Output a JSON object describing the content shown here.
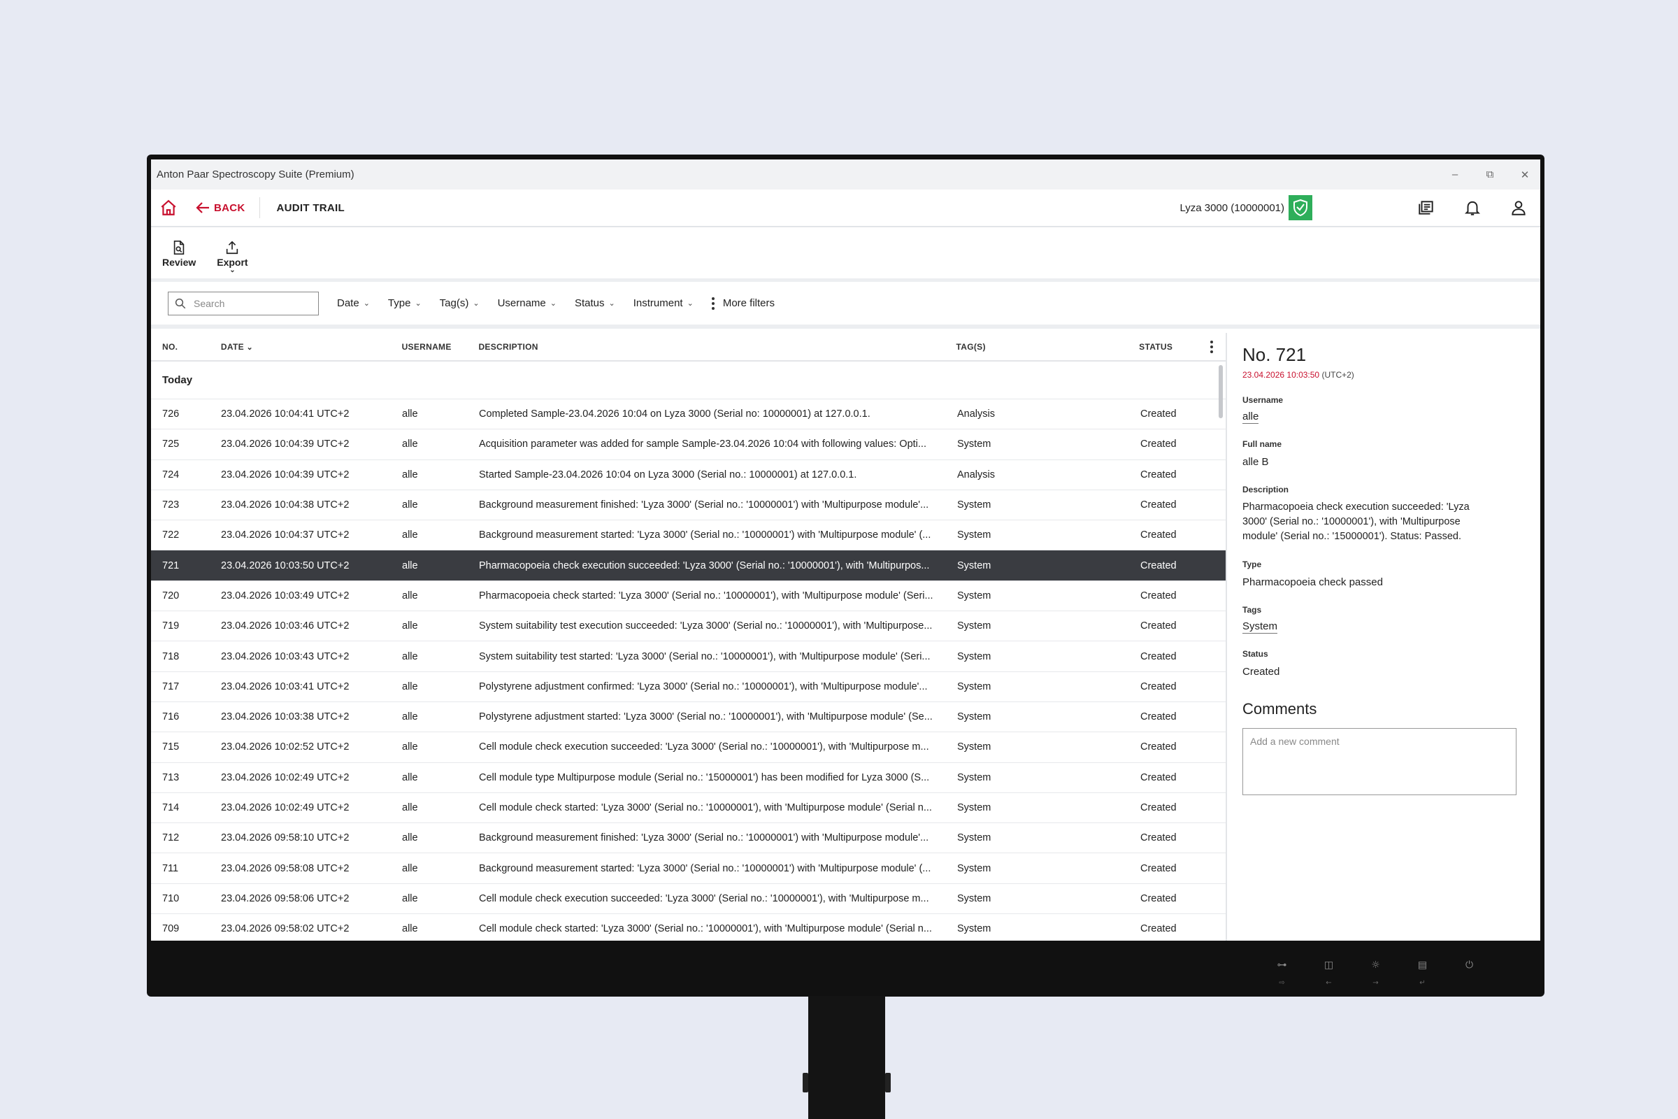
{
  "window": {
    "title": "Anton Paar Spectroscopy Suite (Premium)",
    "minimize": "–",
    "restore": "⧉",
    "close": "✕"
  },
  "appbar": {
    "back_label": "BACK",
    "page_title": "AUDIT TRAIL",
    "instrument": "Lyza 3000 (10000001)",
    "brand_red": "#c8102e",
    "status_green": "#2eae5a"
  },
  "toolbar": {
    "review_label": "Review",
    "export_label": "Export"
  },
  "filters": {
    "search_placeholder": "Search",
    "items": [
      "Date",
      "Type",
      "Tag(s)",
      "Username",
      "Status",
      "Instrument"
    ],
    "more_label": "More filters"
  },
  "table": {
    "columns": {
      "no": "NO.",
      "date": "DATE",
      "username": "USERNAME",
      "description": "DESCRIPTION",
      "tags": "TAG(S)",
      "status": "STATUS"
    },
    "group_label": "Today",
    "rows": [
      {
        "no": "726",
        "date": "23.04.2026 10:04:41 UTC+2",
        "user": "alle",
        "desc": "Completed Sample-23.04.2026 10:04 on Lyza 3000 (Serial no: 10000001) at 127.0.0.1.",
        "tags": "Analysis",
        "status": "Created"
      },
      {
        "no": "725",
        "date": "23.04.2026 10:04:39 UTC+2",
        "user": "alle",
        "desc": "Acquisition parameter was added for sample Sample-23.04.2026 10:04 with following values: Opti...",
        "tags": "System",
        "status": "Created"
      },
      {
        "no": "724",
        "date": "23.04.2026 10:04:39 UTC+2",
        "user": "alle",
        "desc": "Started Sample-23.04.2026 10:04 on Lyza 3000 (Serial no.: 10000001) at 127.0.0.1.",
        "tags": "Analysis",
        "status": "Created"
      },
      {
        "no": "723",
        "date": "23.04.2026 10:04:38 UTC+2",
        "user": "alle",
        "desc": "Background measurement finished: 'Lyza 3000' (Serial no.: '10000001') with 'Multipurpose module'...",
        "tags": "System",
        "status": "Created"
      },
      {
        "no": "722",
        "date": "23.04.2026 10:04:37 UTC+2",
        "user": "alle",
        "desc": "Background measurement started: 'Lyza 3000' (Serial no.: '10000001') with 'Multipurpose module' (...",
        "tags": "System",
        "status": "Created"
      },
      {
        "no": "721",
        "date": "23.04.2026 10:03:50 UTC+2",
        "user": "alle",
        "desc": "Pharmacopoeia check execution succeeded: 'Lyza 3000' (Serial no.: '10000001'), with 'Multipurpos...",
        "tags": "System",
        "status": "Created"
      },
      {
        "no": "720",
        "date": "23.04.2026 10:03:49 UTC+2",
        "user": "alle",
        "desc": "Pharmacopoeia check started: 'Lyza 3000' (Serial no.: '10000001'), with 'Multipurpose module' (Seri...",
        "tags": "System",
        "status": "Created"
      },
      {
        "no": "719",
        "date": "23.04.2026 10:03:46 UTC+2",
        "user": "alle",
        "desc": "System suitability test execution succeeded: 'Lyza 3000' (Serial no.: '10000001'), with 'Multipurpose...",
        "tags": "System",
        "status": "Created"
      },
      {
        "no": "718",
        "date": "23.04.2026 10:03:43 UTC+2",
        "user": "alle",
        "desc": "System suitability test started: 'Lyza 3000' (Serial no.: '10000001'), with 'Multipurpose module' (Seri...",
        "tags": "System",
        "status": "Created"
      },
      {
        "no": "717",
        "date": "23.04.2026 10:03:41 UTC+2",
        "user": "alle",
        "desc": "Polystyrene adjustment confirmed: 'Lyza 3000' (Serial no.: '10000001'), with 'Multipurpose module'...",
        "tags": "System",
        "status": "Created"
      },
      {
        "no": "716",
        "date": "23.04.2026 10:03:38 UTC+2",
        "user": "alle",
        "desc": "Polystyrene adjustment started: 'Lyza 3000' (Serial no.: '10000001'), with 'Multipurpose module' (Se...",
        "tags": "System",
        "status": "Created"
      },
      {
        "no": "715",
        "date": "23.04.2026 10:02:52 UTC+2",
        "user": "alle",
        "desc": "Cell module check execution succeeded: 'Lyza 3000' (Serial no.: '10000001'), with 'Multipurpose m...",
        "tags": "System",
        "status": "Created"
      },
      {
        "no": "713",
        "date": "23.04.2026 10:02:49 UTC+2",
        "user": "alle",
        "desc": "Cell module type Multipurpose module (Serial no.: '15000001') has been modified for Lyza 3000 (S...",
        "tags": "System",
        "status": "Created"
      },
      {
        "no": "714",
        "date": "23.04.2026 10:02:49 UTC+2",
        "user": "alle",
        "desc": "Cell module check started: 'Lyza 3000' (Serial no.: '10000001'), with 'Multipurpose module' (Serial n...",
        "tags": "System",
        "status": "Created"
      },
      {
        "no": "712",
        "date": "23.04.2026 09:58:10 UTC+2",
        "user": "alle",
        "desc": "Background measurement finished: 'Lyza 3000' (Serial no.: '10000001') with 'Multipurpose module'...",
        "tags": "System",
        "status": "Created"
      },
      {
        "no": "711",
        "date": "23.04.2026 09:58:08 UTC+2",
        "user": "alle",
        "desc": "Background measurement started: 'Lyza 3000' (Serial no.: '10000001') with 'Multipurpose module' (...",
        "tags": "System",
        "status": "Created"
      },
      {
        "no": "710",
        "date": "23.04.2026 09:58:06 UTC+2",
        "user": "alle",
        "desc": "Cell module check execution succeeded: 'Lyza 3000' (Serial no.: '10000001'), with 'Multipurpose m...",
        "tags": "System",
        "status": "Created"
      },
      {
        "no": "709",
        "date": "23.04.2026 09:58:02 UTC+2",
        "user": "alle",
        "desc": "Cell module check started: 'Lyza 3000' (Serial no.: '10000001'), with 'Multipurpose module' (Serial n...",
        "tags": "System",
        "status": "Created"
      }
    ],
    "selected_index": 5
  },
  "detail": {
    "title": "No. 721",
    "timestamp": "23.04.2026 10:03:50",
    "timezone": "(UTC+2)",
    "username_label": "Username",
    "username": "alle",
    "fullname_label": "Full name",
    "fullname": "alle B",
    "description_label": "Description",
    "description": "Pharmacopoeia check execution succeeded: 'Lyza 3000' (Serial no.: '10000001'), with 'Multipurpose module' (Serial no.: '15000001'). Status: Passed.",
    "type_label": "Type",
    "type": "Pharmacopoeia check passed",
    "tags_label": "Tags",
    "tags": "System",
    "status_label": "Status",
    "status": "Created",
    "comments_heading": "Comments",
    "comment_placeholder": "Add a new comment"
  },
  "bezel": {
    "buttons": [
      {
        "icon": "input-icon",
        "glyph": "⊶",
        "sub": "⇨"
      },
      {
        "icon": "mode-icon",
        "glyph": "◫",
        "sub": "←"
      },
      {
        "icon": "brightness-icon",
        "glyph": "☼",
        "sub": "→"
      },
      {
        "icon": "menu-icon",
        "glyph": "▤",
        "sub": "↵"
      },
      {
        "icon": "power-icon",
        "glyph": "⏻",
        "sub": ""
      }
    ]
  }
}
